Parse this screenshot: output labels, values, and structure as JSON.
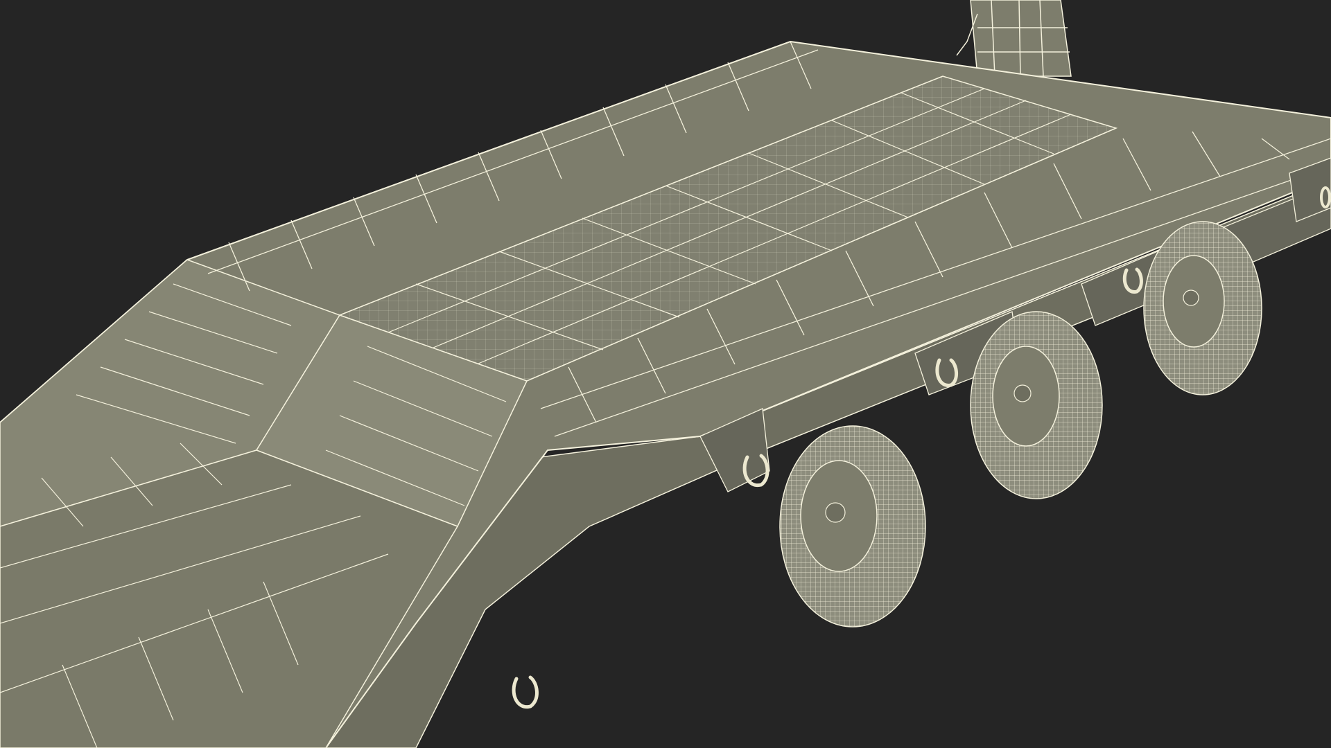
{
  "scene": {
    "subject": "lowboy-trailer-wireframe-render",
    "colors": {
      "background": "#252525",
      "surface": "#7d7d6c",
      "surface_light": "#8a8a78",
      "surface_dark": "#5f5f52",
      "wire": "#f4f1dc",
      "tire": "#8d8d7d",
      "shackle": "#ece8cf"
    },
    "counts": {
      "axles_visible": 3,
      "tie_down_shackles_visible": 4
    }
  }
}
